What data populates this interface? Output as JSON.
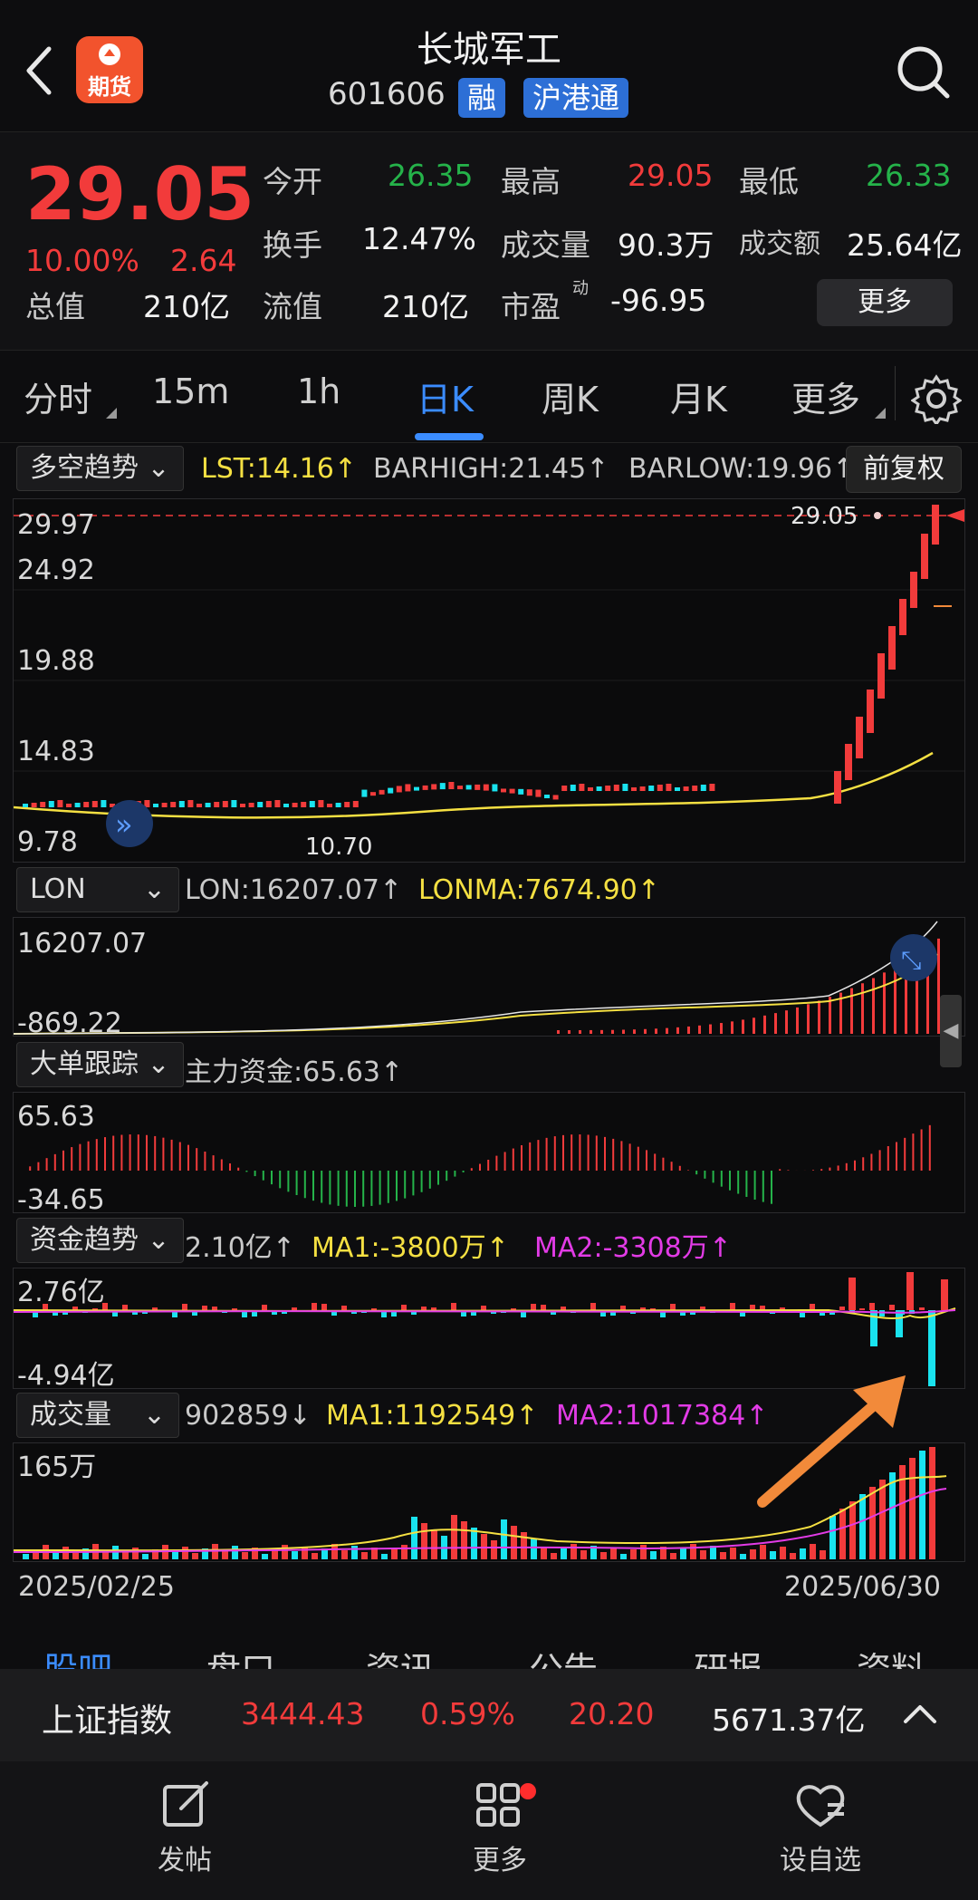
{
  "header": {
    "title": "长城军工",
    "code": "601606",
    "badge1": "融",
    "badge2": "沪港通",
    "logo_text": "期货"
  },
  "quote": {
    "price": "29.05",
    "pct": "10.00%",
    "change": "2.64",
    "total_value_label": "总值",
    "total_value": "210亿",
    "open_label": "今开",
    "open": "26.35",
    "high_label": "最高",
    "high": "29.05",
    "low_label": "最低",
    "low": "26.33",
    "turnover_label": "换手",
    "turnover": "12.47%",
    "volume_label": "成交量",
    "volume": "90.3万",
    "amount_label": "成交额",
    "amount": "25.64亿",
    "float_label": "流值",
    "float_value": "210亿",
    "pe_label": "市盈",
    "pe_sup": "动",
    "pe": "-96.95",
    "more_button": "更多"
  },
  "tabs": [
    "分时",
    "15m",
    "1h",
    "日K",
    "周K",
    "月K",
    "更多"
  ],
  "active_tab": "日K",
  "kline": {
    "selector": "多空趋势",
    "lst": "LST:14.16↑",
    "barhigh": "BARHIGH:21.45↑",
    "barlow": "BARLOW:19.96↑",
    "adjust_button": "前复权",
    "axis": [
      "29.97",
      "24.92",
      "19.88",
      "14.83",
      "9.78"
    ],
    "last_price_label": "29.05",
    "low_label": "10.70"
  },
  "lon": {
    "selector": "LON",
    "lon": "LON:16207.07↑",
    "lonma": "LONMA:7674.90↑",
    "axis_top": "16207.07",
    "axis_bottom": "-869.22"
  },
  "bigorder": {
    "selector": "大单跟踪",
    "text": "主力资金:65.63↑",
    "axis_top": "65.63",
    "axis_bottom": "-34.65"
  },
  "fund": {
    "selector": "资金趋势",
    "value": "2.10亿↑",
    "ma1": "MA1:-3800万↑",
    "ma2": "MA2:-3308万↑",
    "axis_top": "2.76亿",
    "axis_bottom": "-4.94亿"
  },
  "volume": {
    "selector": "成交量",
    "value": "902859↓",
    "ma1": "MA1:1192549↑",
    "ma2": "MA2:1017384↑",
    "axis_top": "165万",
    "date_start": "2025/02/25",
    "date_end": "2025/06/30"
  },
  "bottom_tabs": [
    "股吧",
    "盘口",
    "资讯",
    "公告",
    "研报",
    "资料"
  ],
  "index_bar": {
    "name": "上证指数",
    "value": "3444.43",
    "pct": "0.59%",
    "change": "20.20",
    "amount": "5671.37亿"
  },
  "nav": {
    "post": "发帖",
    "more": "更多",
    "watch": "设自选"
  },
  "colors": {
    "up": "#f23b3b",
    "down": "#25b34a",
    "cyan": "#19e3ef",
    "yellow": "#f5e042",
    "magenta": "#e23be6",
    "accent_blue": "#2d6fd6",
    "arrow_orange": "#f28a3a"
  }
}
